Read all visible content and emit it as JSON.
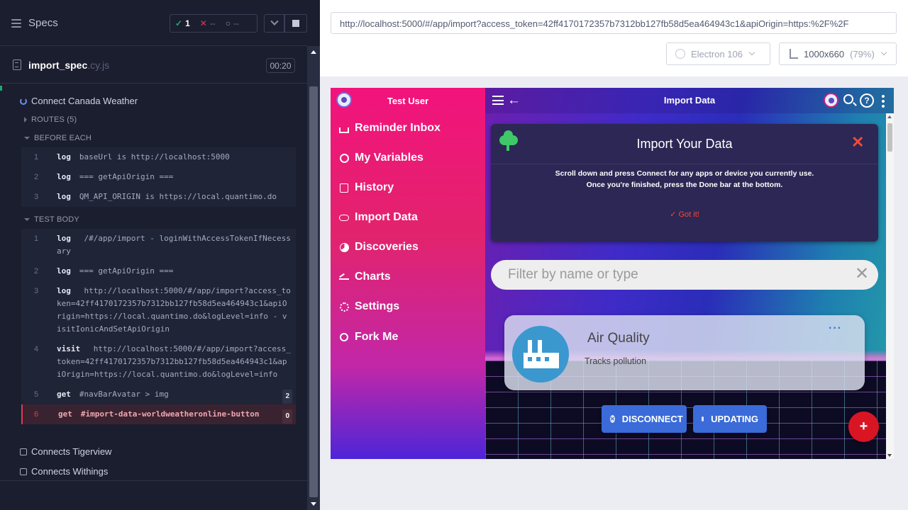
{
  "reporter": {
    "header": {
      "specs_label": "Specs",
      "passed_count": "1",
      "failed_count": "--",
      "pending_count": "--"
    },
    "spec": {
      "name": "import_spec",
      "ext": ".cy.js",
      "duration": "00:20"
    },
    "tests": {
      "current": "Connect Canada Weather",
      "routes_label": "ROUTES (5)",
      "before_each_label": "BEFORE EACH",
      "test_body_label": "TEST BODY",
      "next1": "Connects Tigerview",
      "next2": "Connects Withings"
    },
    "before_each": [
      {
        "num": "1",
        "name": "log",
        "msg": "baseUrl is http://localhost:5000"
      },
      {
        "num": "2",
        "name": "log",
        "msg": "=== getApiOrigin ==="
      },
      {
        "num": "3",
        "name": "log",
        "msg": "QM_API_ORIGIN is https://local.quantimo.do"
      }
    ],
    "test_body": [
      {
        "num": "1",
        "name": "log",
        "msg": "/#/app/import - loginWithAccessTokenIfNecessary"
      },
      {
        "num": "2",
        "name": "log",
        "msg": "=== getApiOrigin ==="
      },
      {
        "num": "3",
        "name": "log",
        "msg": "http://localhost:5000/#/app/import?access_token=42ff4170172357b7312bb127fb58d5ea464943c1&apiOrigin=https://local.quantimo.do&logLevel=info - visitIonicAndSetApiOrigin"
      },
      {
        "num": "4",
        "name": "visit",
        "msg": "http://localhost:5000/#/app/import?access_token=42ff4170172357b7312bb127fb58d5ea464943c1&apiOrigin=https://local.quantimo.do&logLevel=info"
      },
      {
        "num": "5",
        "name": "get",
        "msg": "#navBarAvatar > img",
        "badge": "2"
      },
      {
        "num": "6",
        "name": "get",
        "msg": "#import-data-worldweatheronline-button",
        "badge": "0"
      }
    ]
  },
  "runner": {
    "url": "http://localhost:5000/#/app/import?access_token=42ff4170172357b7312bb127fb58d5ea464943c1&apiOrigin=https:%2F%2F",
    "browser": "Electron 106",
    "viewport": "1000x660",
    "viewport_scale": "(79%)"
  },
  "app": {
    "menu": {
      "user": "Test User",
      "items": [
        {
          "label": "Reminder Inbox",
          "icon": "inbox-icon"
        },
        {
          "label": "My Variables",
          "icon": "globe-icon"
        },
        {
          "label": "History",
          "icon": "list-icon"
        },
        {
          "label": "Import Data",
          "icon": "cloud-upload-icon"
        },
        {
          "label": "Discoveries",
          "icon": "pie-icon"
        },
        {
          "label": "Charts",
          "icon": "trend-icon"
        },
        {
          "label": "Settings",
          "icon": "gear-icon"
        },
        {
          "label": "Fork Me",
          "icon": "github-icon"
        }
      ]
    },
    "header": {
      "title": "Import Data"
    },
    "import_card": {
      "title": "Import Your Data",
      "line1": "Scroll down and press Connect for any apps or device you currently use.",
      "line2": "Once you're finished, press the Done bar at the bottom.",
      "got_it": "Got it!"
    },
    "filter": {
      "placeholder": "Filter by name or type"
    },
    "connector": {
      "name": "Air Quality",
      "description": "Tracks pollution"
    },
    "buttons": {
      "disconnect": "DISCONNECT",
      "updating": "UPDATING"
    },
    "colors": {
      "accent_red": "#f24a3a",
      "button_blue": "#3a6bd8",
      "fab_red": "#d91524",
      "cypress_pass": "#1fa971",
      "cypress_fail": "#e2394d"
    }
  }
}
